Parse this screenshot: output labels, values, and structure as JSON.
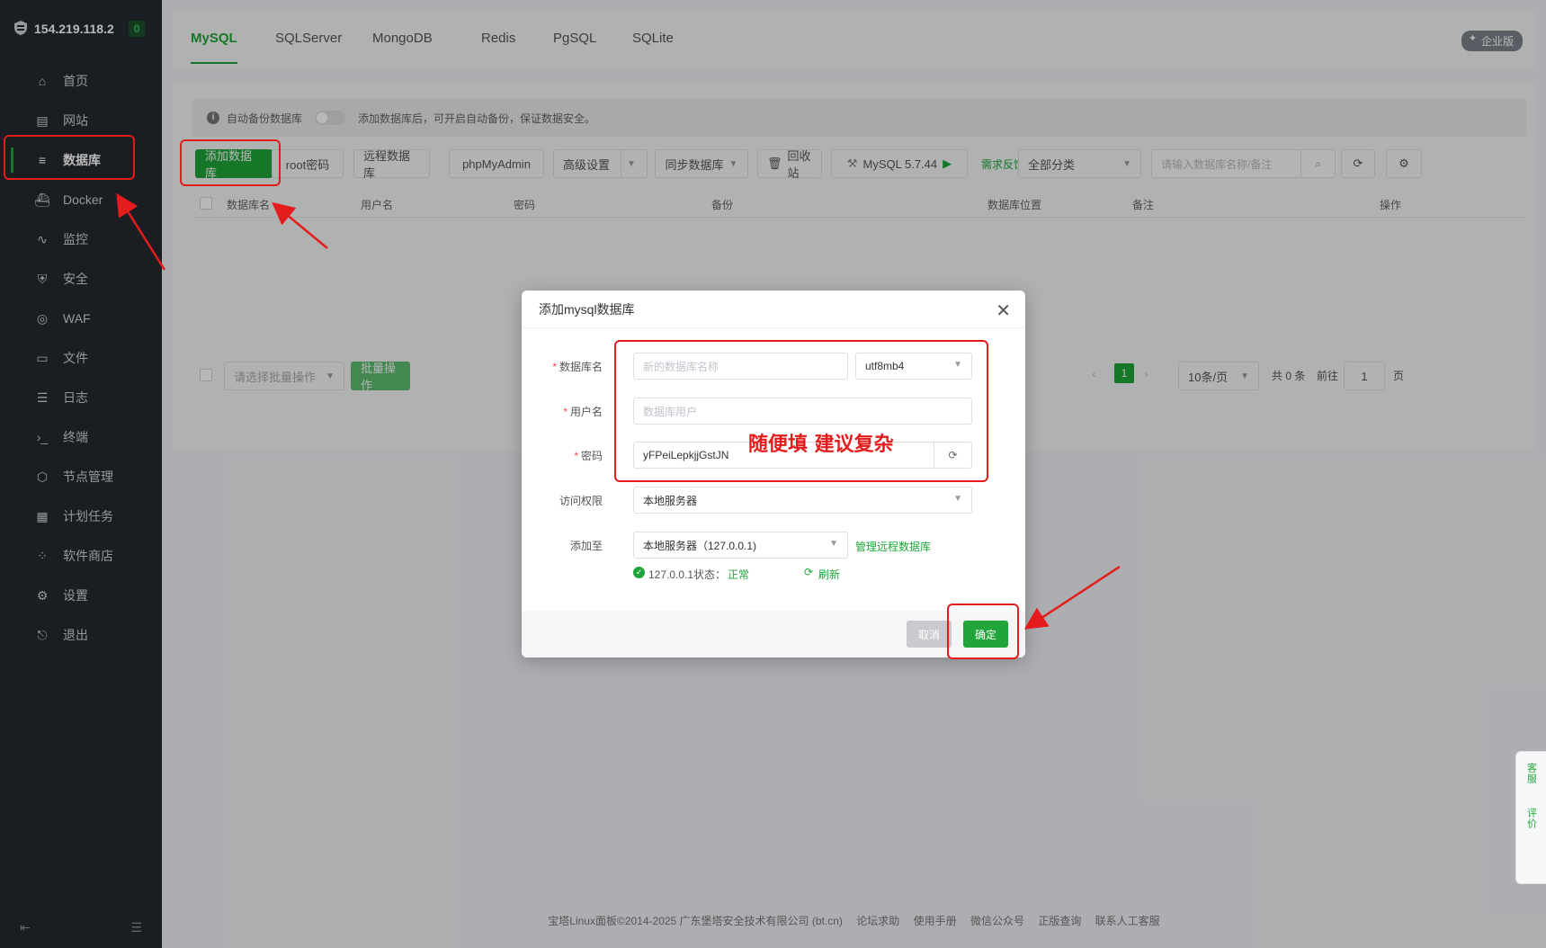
{
  "sidebar": {
    "ip": "154.219.118.2",
    "badge": "0",
    "items": [
      {
        "label": "首页",
        "icon": "home-icon"
      },
      {
        "label": "网站",
        "icon": "website-icon"
      },
      {
        "label": "数据库",
        "icon": "database-icon"
      },
      {
        "label": "Docker",
        "icon": "docker-icon"
      },
      {
        "label": "监控",
        "icon": "monitor-icon"
      },
      {
        "label": "安全",
        "icon": "shield-icon"
      },
      {
        "label": "WAF",
        "icon": "waf-icon"
      },
      {
        "label": "文件",
        "icon": "folder-icon"
      },
      {
        "label": "日志",
        "icon": "log-icon"
      },
      {
        "label": "终端",
        "icon": "terminal-icon"
      },
      {
        "label": "节点管理",
        "icon": "node-icon"
      },
      {
        "label": "计划任务",
        "icon": "calendar-icon"
      },
      {
        "label": "软件商店",
        "icon": "store-icon"
      },
      {
        "label": "设置",
        "icon": "gear-icon"
      },
      {
        "label": "退出",
        "icon": "logout-icon"
      }
    ]
  },
  "tabs": [
    "MySQL",
    "SQLServer",
    "MongoDB",
    "Redis",
    "PgSQL",
    "SQLite"
  ],
  "enterprise_badge": "企业版",
  "tip": {
    "label": "自动备份数据库",
    "text": "添加数据库后，可开启自动备份，保证数据安全。"
  },
  "toolbar": {
    "add_db": "添加数据库",
    "root_pwd": "root密码",
    "remote_db": "远程数据库",
    "phpmyadmin": "phpMyAdmin",
    "advanced": "高级设置",
    "sync_db": "同步数据库",
    "recycle": "回收站",
    "mysql_version": "MySQL 5.7.44",
    "feedback": "需求反馈",
    "category": "全部分类",
    "search_placeholder": "请输入数据库名称/备注"
  },
  "table": {
    "headers": [
      "数据库名",
      "用户名",
      "密码",
      "备份",
      "数据库位置",
      "备注",
      "操作"
    ]
  },
  "batch": {
    "select_placeholder": "请选择批量操作",
    "button": "批量操作"
  },
  "pagination": {
    "current_page": "1",
    "per_page": "10条/页",
    "total": "共 0 条",
    "goto": "前往",
    "goto_value": "1",
    "page_suffix": "页"
  },
  "modal": {
    "title": "添加mysql数据库",
    "db_name_label": "数据库名",
    "db_name_placeholder": "新的数据库名称",
    "charset": "utf8mb4",
    "user_label": "用户名",
    "user_placeholder": "数据库用户",
    "password_label": "密码",
    "password_value": "yFPeiLepkjjGstJN",
    "access_label": "访问权限",
    "access_value": "本地服务器",
    "add_to_label": "添加至",
    "add_to_value": "本地服务器（127.0.0.1)",
    "manage_remote": "管理远程数据库",
    "status_host": "127.0.0.1状态：",
    "status_value": "正常",
    "refresh": "刷新",
    "cancel": "取消",
    "confirm": "确定"
  },
  "annotation": {
    "text": "随便填 建议复杂",
    "color": "#e51c1c"
  },
  "side_widget": {
    "service": "客服",
    "review": "评价"
  },
  "footer": {
    "copyright": "宝塔Linux面板©2014-2025 广东堡塔安全技术有限公司 (bt.cn)",
    "links": [
      "论坛求助",
      "使用手册",
      "微信公众号",
      "正版查询",
      "联系人工客服"
    ]
  },
  "colors": {
    "accent": "#20a53a",
    "sidebar_bg": "#252a31",
    "annotation_red": "#e51c1c"
  }
}
